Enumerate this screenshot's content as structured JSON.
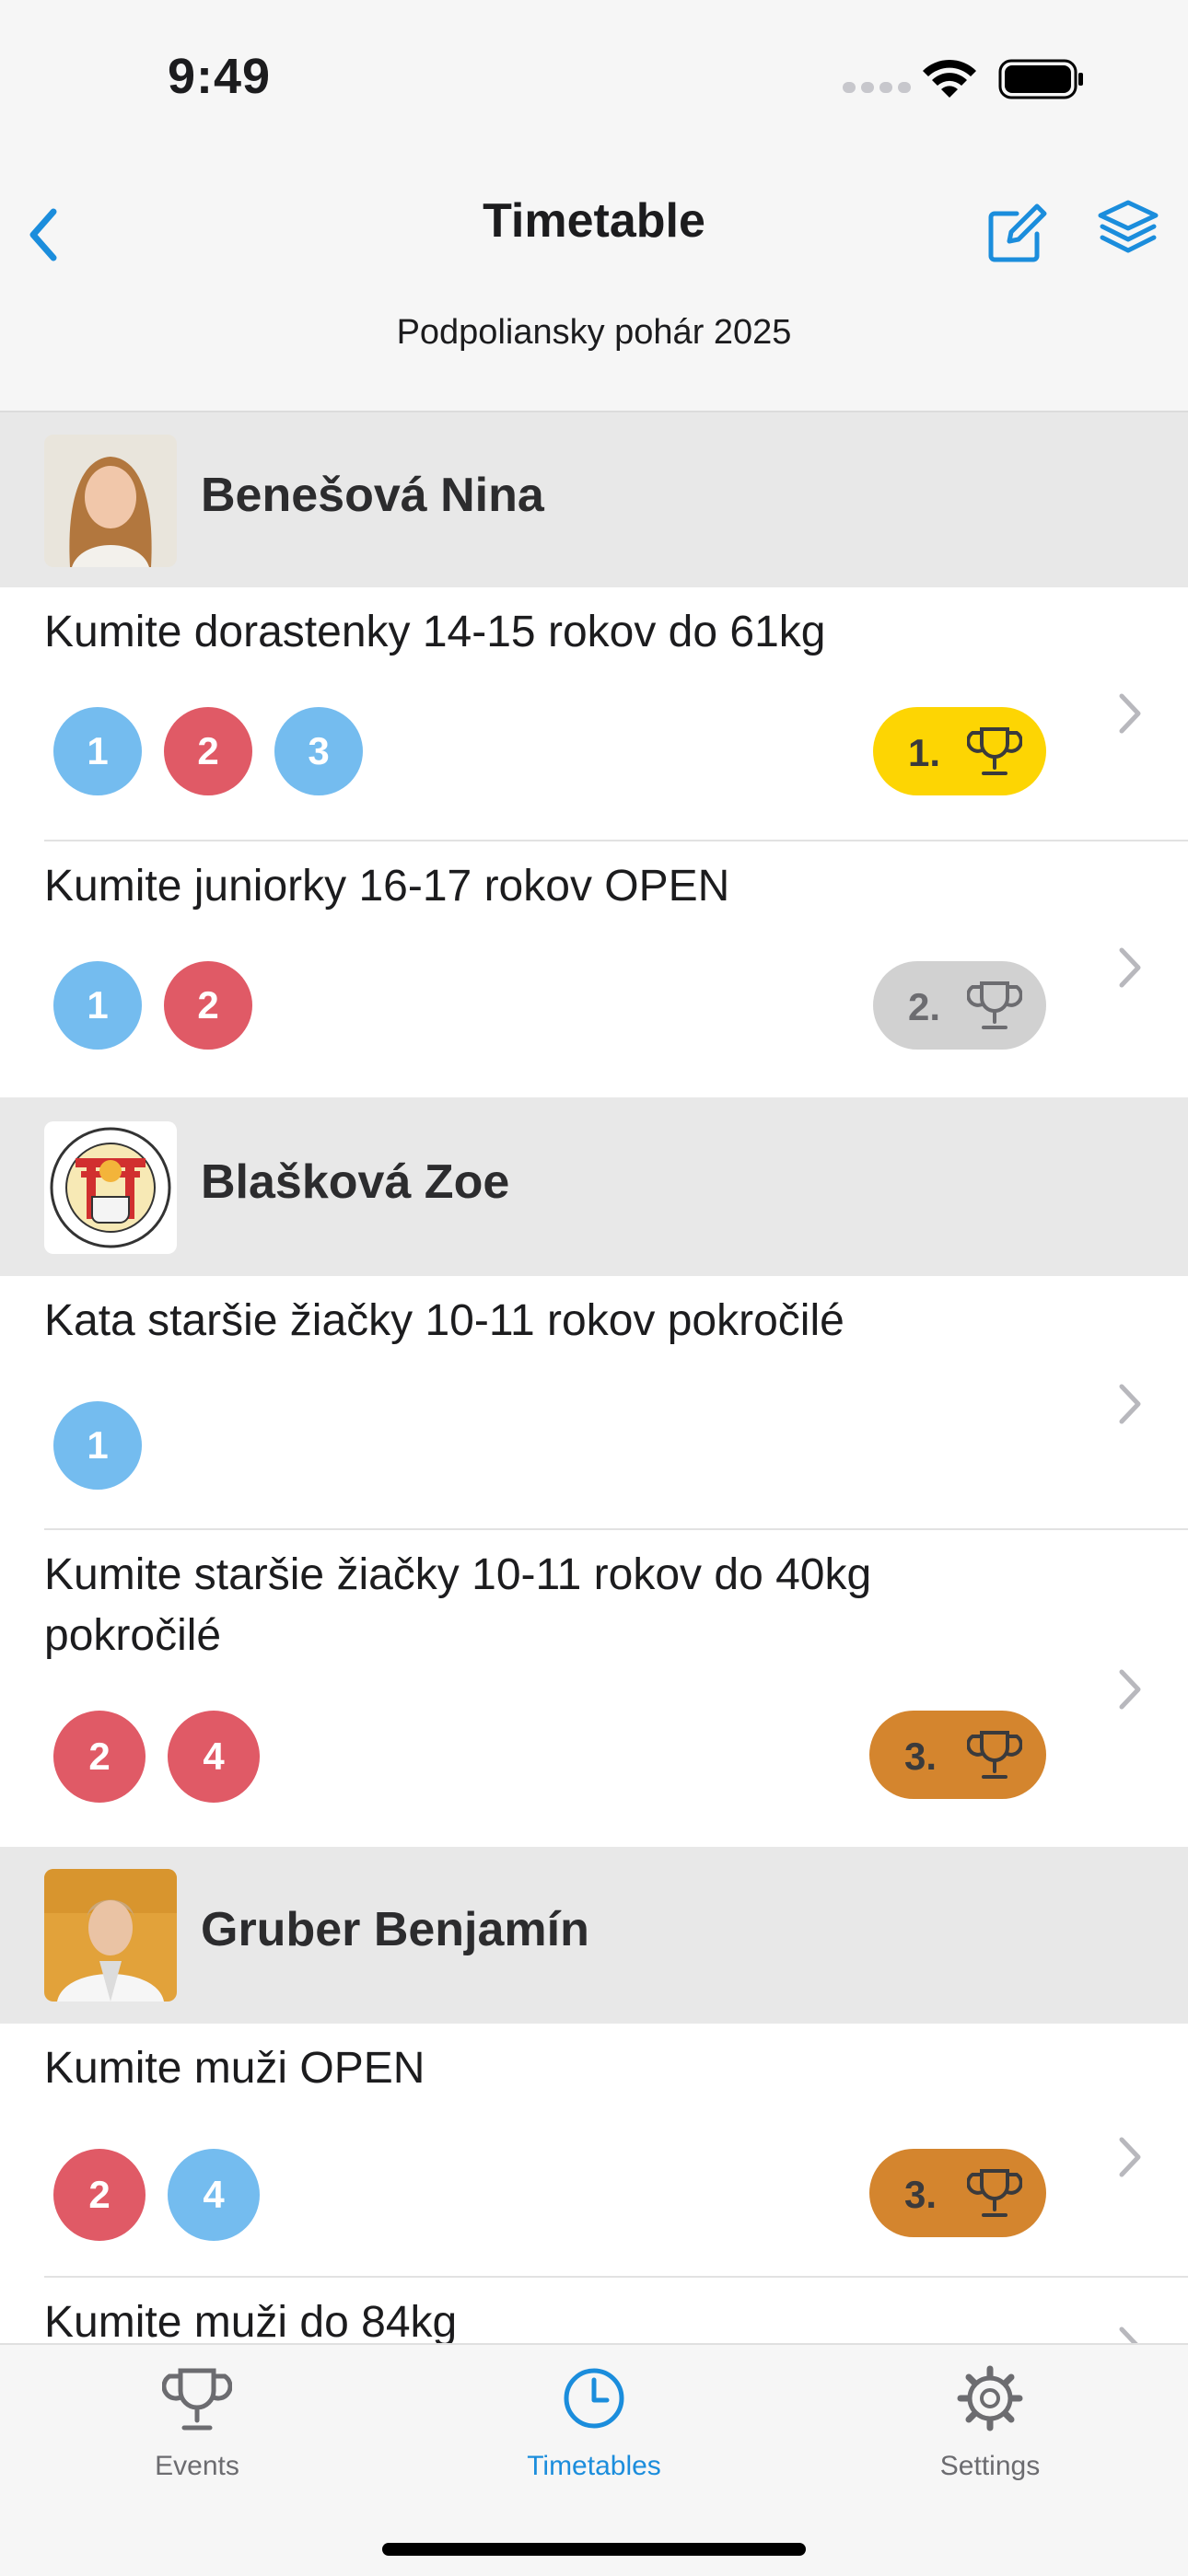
{
  "status_bar": {
    "time": "9:49"
  },
  "nav": {
    "title": "Timetable",
    "subtitle": "Podpoliansky pohár 2025"
  },
  "colors": {
    "accent": "#1b8ddc",
    "round_blue": "#74bcef",
    "round_red": "#e05a66",
    "gold": "#fdd503",
    "silver": "#d1d1d1",
    "bronze": "#d4852e"
  },
  "athletes": [
    {
      "name": "Benešová Nina",
      "events": [
        {
          "title": "Kumite dorastenky 14-15 rokov do 61kg",
          "rounds": [
            "1",
            "2",
            "3"
          ],
          "place": "1."
        },
        {
          "title": "Kumite juniorky 16-17 rokov OPEN",
          "rounds": [
            "1",
            "2"
          ],
          "place": "2."
        }
      ]
    },
    {
      "name": "Blašková Zoe",
      "events": [
        {
          "title": "Kata staršie žiačky 10-11 rokov pokročilé",
          "rounds": [
            "1"
          ],
          "place": ""
        },
        {
          "title": "Kumite staršie žiačky 10-11 rokov do 40kg pokročilé",
          "rounds": [
            "2",
            "4"
          ],
          "place": "3."
        }
      ]
    },
    {
      "name": "Gruber Benjamín",
      "events": [
        {
          "title": "Kumite muži OPEN",
          "rounds": [
            "2",
            "4"
          ],
          "place": "3."
        },
        {
          "title": "Kumite muži do 84kg",
          "rounds": [],
          "place": ""
        }
      ]
    }
  ],
  "tabs": [
    {
      "label": "Events",
      "icon": "trophy-icon"
    },
    {
      "label": "Timetables",
      "icon": "clock-icon"
    },
    {
      "label": "Settings",
      "icon": "gear-icon"
    }
  ]
}
